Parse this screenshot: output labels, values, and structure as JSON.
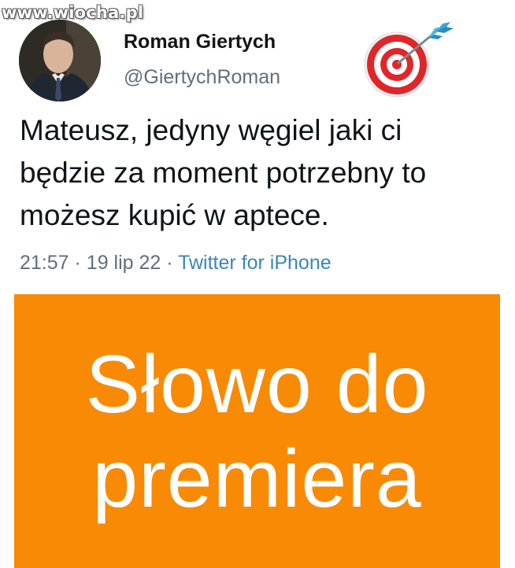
{
  "watermark": "www.wiocha.pl",
  "tweet": {
    "author_name": "Roman Giertych",
    "author_handle": "@GiertychRoman",
    "text_lines": [
      "Mateusz, jedyny węgiel jaki ci",
      "będzie za moment potrzebny to",
      "możesz kupić w aptece."
    ],
    "time": "21:57",
    "separator": "·",
    "date": "19 lip 22",
    "source": "Twitter for iPhone",
    "emoji": "direct-hit-target-icon"
  },
  "banner": {
    "line1": "Słowo do",
    "line2": "premiera",
    "background_color": "#f88a06",
    "text_color": "#ffffff"
  },
  "colors": {
    "secondary_text": "#5f6f7c",
    "source_link": "#3a86b8"
  }
}
